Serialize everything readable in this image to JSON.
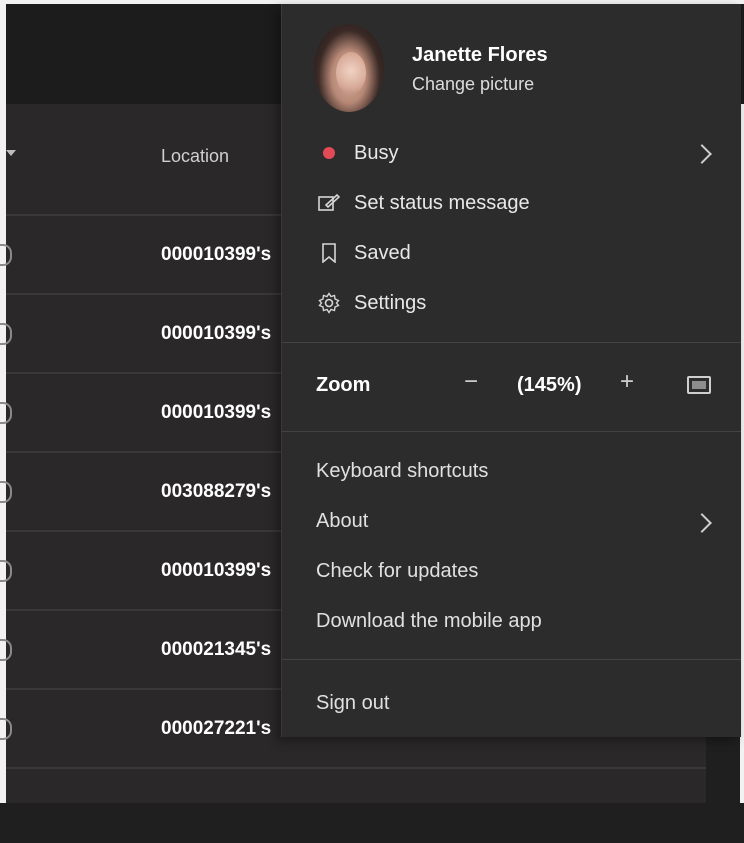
{
  "table": {
    "column_location": "Location",
    "rows": [
      {
        "location": "000010399's"
      },
      {
        "location": "000010399's"
      },
      {
        "location": "000010399's"
      },
      {
        "location": "003088279's"
      },
      {
        "location": "000010399's"
      },
      {
        "location": "000021345's"
      },
      {
        "location": "000027221's"
      }
    ]
  },
  "profile_menu": {
    "user_name": "Janette Flores",
    "change_picture": "Change picture",
    "status": {
      "label": "Busy",
      "color": "#e34a55"
    },
    "items": [
      {
        "label": "Set status message",
        "icon": "edit-status-icon"
      },
      {
        "label": "Saved",
        "icon": "bookmark-icon"
      },
      {
        "label": "Settings",
        "icon": "gear-icon"
      }
    ],
    "zoom": {
      "label": "Zoom",
      "value": "(145%)",
      "minus": "−",
      "plus": "+"
    },
    "links": {
      "keyboard_shortcuts": "Keyboard shortcuts",
      "about": "About",
      "check_updates": "Check for updates",
      "download_mobile": "Download the mobile app"
    },
    "sign_out": "Sign out"
  }
}
